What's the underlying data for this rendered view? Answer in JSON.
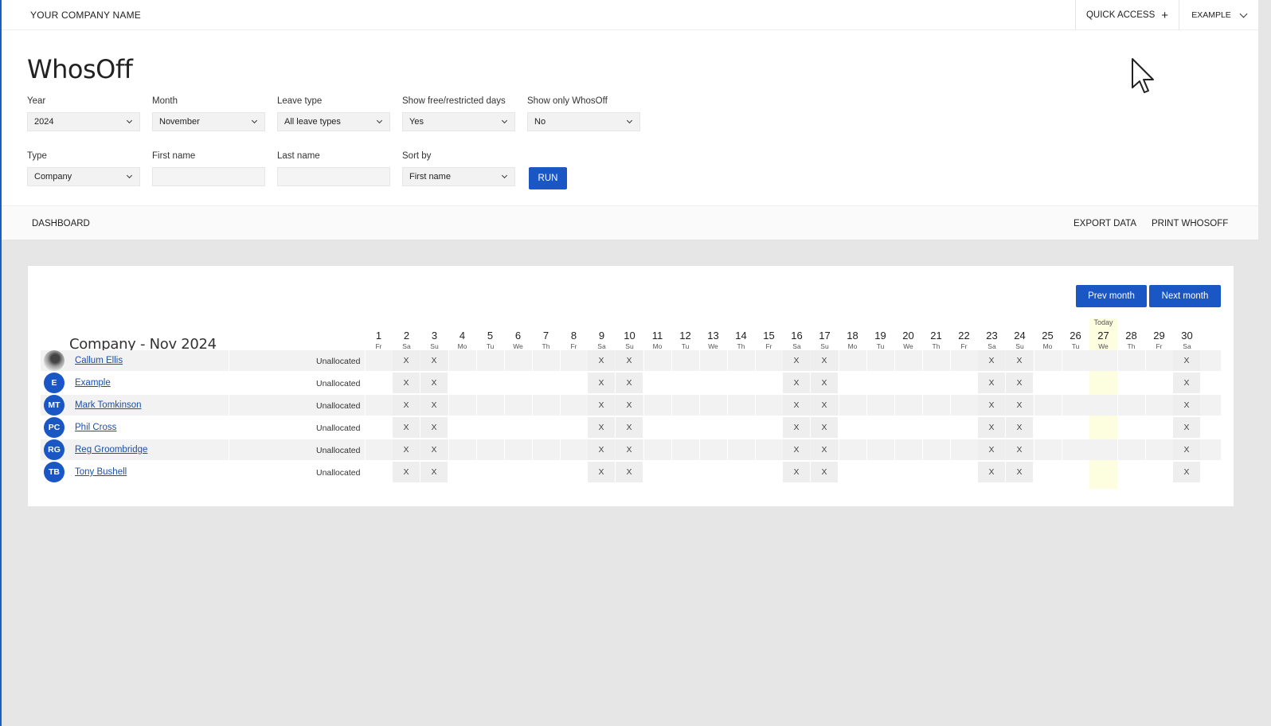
{
  "topbar": {
    "company": "YOUR COMPANY NAME",
    "quick_access": "QUICK ACCESS",
    "account": "EXAMPLE"
  },
  "header": {
    "title": "WhosOff",
    "filters": {
      "year": {
        "label": "Year",
        "value": "2024"
      },
      "month": {
        "label": "Month",
        "value": "November"
      },
      "leave_type": {
        "label": "Leave type",
        "value": "All leave types"
      },
      "free_days": {
        "label": "Show free/restricted days",
        "value": "Yes"
      },
      "only_whosoff": {
        "label": "Show only WhosOff",
        "value": "No"
      },
      "type": {
        "label": "Type",
        "value": "Company"
      },
      "first_name": {
        "label": "First name",
        "value": ""
      },
      "last_name": {
        "label": "Last name",
        "value": ""
      },
      "sort_by": {
        "label": "Sort by",
        "value": "First name"
      }
    },
    "run_label": "RUN"
  },
  "nav": {
    "dashboard": "DASHBOARD",
    "export": "EXPORT DATA",
    "print": "PRINT WHOSOFF"
  },
  "calendar": {
    "prev_label": "Prev month",
    "next_label": "Next month",
    "title": "Company - Nov 2024",
    "today_label": "Today",
    "today_day": 27,
    "mark": "X",
    "days": [
      {
        "n": "1",
        "d": "Fr"
      },
      {
        "n": "2",
        "d": "Sa"
      },
      {
        "n": "3",
        "d": "Su"
      },
      {
        "n": "4",
        "d": "Mo"
      },
      {
        "n": "5",
        "d": "Tu"
      },
      {
        "n": "6",
        "d": "We"
      },
      {
        "n": "7",
        "d": "Th"
      },
      {
        "n": "8",
        "d": "Fr"
      },
      {
        "n": "9",
        "d": "Sa"
      },
      {
        "n": "10",
        "d": "Su"
      },
      {
        "n": "11",
        "d": "Mo"
      },
      {
        "n": "12",
        "d": "Tu"
      },
      {
        "n": "13",
        "d": "We"
      },
      {
        "n": "14",
        "d": "Th"
      },
      {
        "n": "15",
        "d": "Fr"
      },
      {
        "n": "16",
        "d": "Sa"
      },
      {
        "n": "17",
        "d": "Su"
      },
      {
        "n": "18",
        "d": "Mo"
      },
      {
        "n": "19",
        "d": "Tu"
      },
      {
        "n": "20",
        "d": "We"
      },
      {
        "n": "21",
        "d": "Th"
      },
      {
        "n": "22",
        "d": "Fr"
      },
      {
        "n": "23",
        "d": "Sa"
      },
      {
        "n": "24",
        "d": "Su"
      },
      {
        "n": "25",
        "d": "Mo"
      },
      {
        "n": "26",
        "d": "Tu"
      },
      {
        "n": "27",
        "d": "We"
      },
      {
        "n": "28",
        "d": "Th"
      },
      {
        "n": "29",
        "d": "Fr"
      },
      {
        "n": "30",
        "d": "Sa"
      }
    ],
    "people": [
      {
        "name": "Callum Ellis",
        "initials": "",
        "photo": true,
        "dept": "Unallocated"
      },
      {
        "name": "Example",
        "initials": "E",
        "photo": false,
        "dept": "Unallocated"
      },
      {
        "name": "Mark Tomkinson",
        "initials": "MT",
        "photo": false,
        "dept": "Unallocated"
      },
      {
        "name": "Phil Cross",
        "initials": "PC",
        "photo": false,
        "dept": "Unallocated"
      },
      {
        "name": "Reg Groombridge",
        "initials": "RG",
        "photo": false,
        "dept": "Unallocated"
      },
      {
        "name": "Tony Bushell",
        "initials": "TB",
        "photo": false,
        "dept": "Unallocated"
      }
    ],
    "colors": {
      "row_alt": "#f2f2f2",
      "weekend": "#eeeeee",
      "today": "#fdfde0",
      "accent": "#1a56c4"
    }
  }
}
